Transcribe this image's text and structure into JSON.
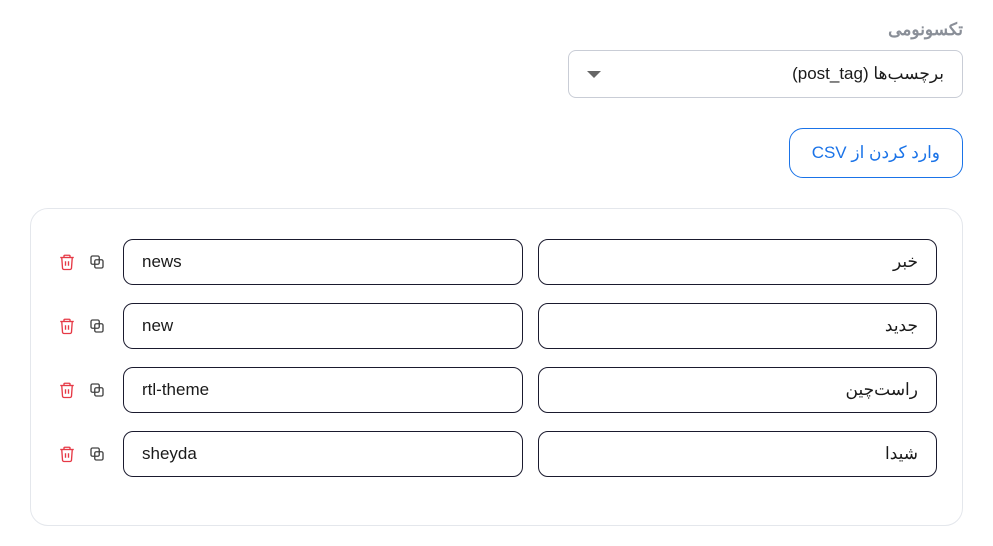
{
  "taxonomy": {
    "label": "تکسونومی",
    "selected": "برچسب‌ها (post_tag)"
  },
  "import": {
    "csv_label": "وارد کردن از CSV"
  },
  "items": [
    {
      "name": "خبر",
      "slug": "news"
    },
    {
      "name": "جدید",
      "slug": "new"
    },
    {
      "name": "راست‌چین",
      "slug": "rtl-theme"
    },
    {
      "name": "شیدا",
      "slug": "sheyda"
    }
  ]
}
